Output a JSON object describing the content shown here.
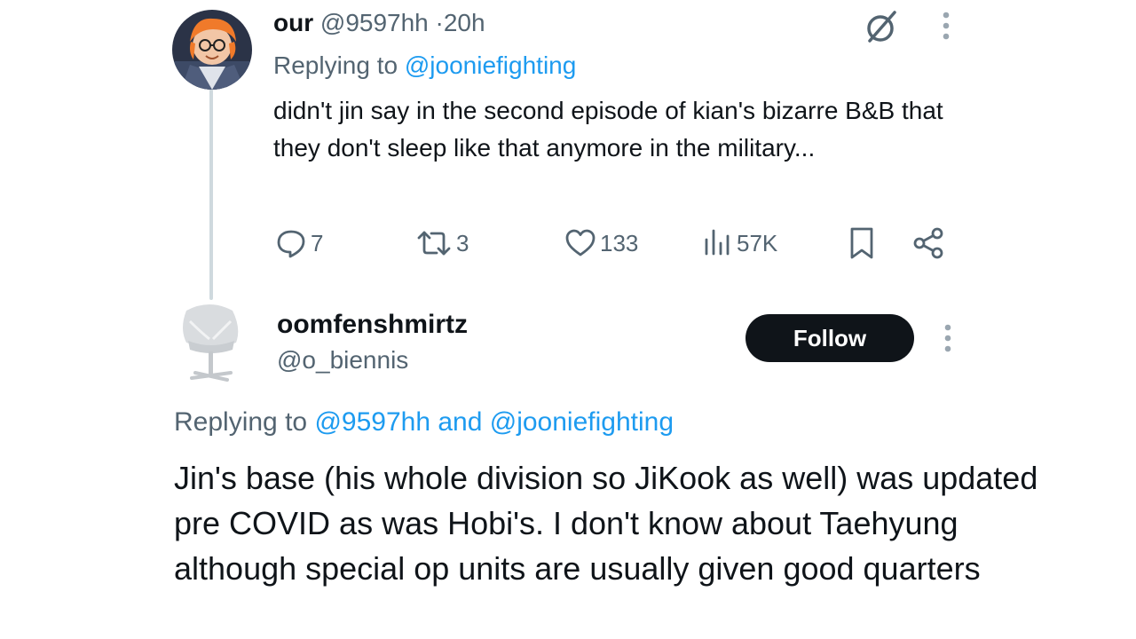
{
  "tweet1": {
    "display_name": "our",
    "handle": "@9597hh",
    "separator": "·",
    "time": "20h",
    "replying_prefix": "Replying to",
    "replying_to": "@jooniefighting",
    "body": "didn't jin say in the second episode of kian's bizarre B&B that they don't sleep like that anymore in the military...",
    "replies": "7",
    "reposts": "3",
    "likes": "133",
    "views": "57K",
    "icons": {
      "grok": "grok-icon",
      "more": "more-vertical-icon",
      "reply": "reply-icon",
      "repost": "repost-icon",
      "like": "heart-icon",
      "views": "views-chart-icon",
      "bookmark": "bookmark-icon",
      "share": "share-icon"
    }
  },
  "tweet2": {
    "display_name": "oomfenshmirtz",
    "handle": "@o_biennis",
    "follow_label": "Follow",
    "replying_prefix": "Replying to",
    "replying_to_1": "@9597hh",
    "replying_and": "and",
    "replying_to_2": "@jooniefighting",
    "body": "Jin's base (his whole division so JiKook as well) was updated pre COVID as was Hobi's.  I don't know about Taehyung although special op units are usually given good quarters"
  },
  "colors": {
    "text": "#0f1419",
    "muted": "#536471",
    "link": "#1d9bf0",
    "follow_bg": "#0f1419",
    "thread_line": "#cfd9de"
  }
}
